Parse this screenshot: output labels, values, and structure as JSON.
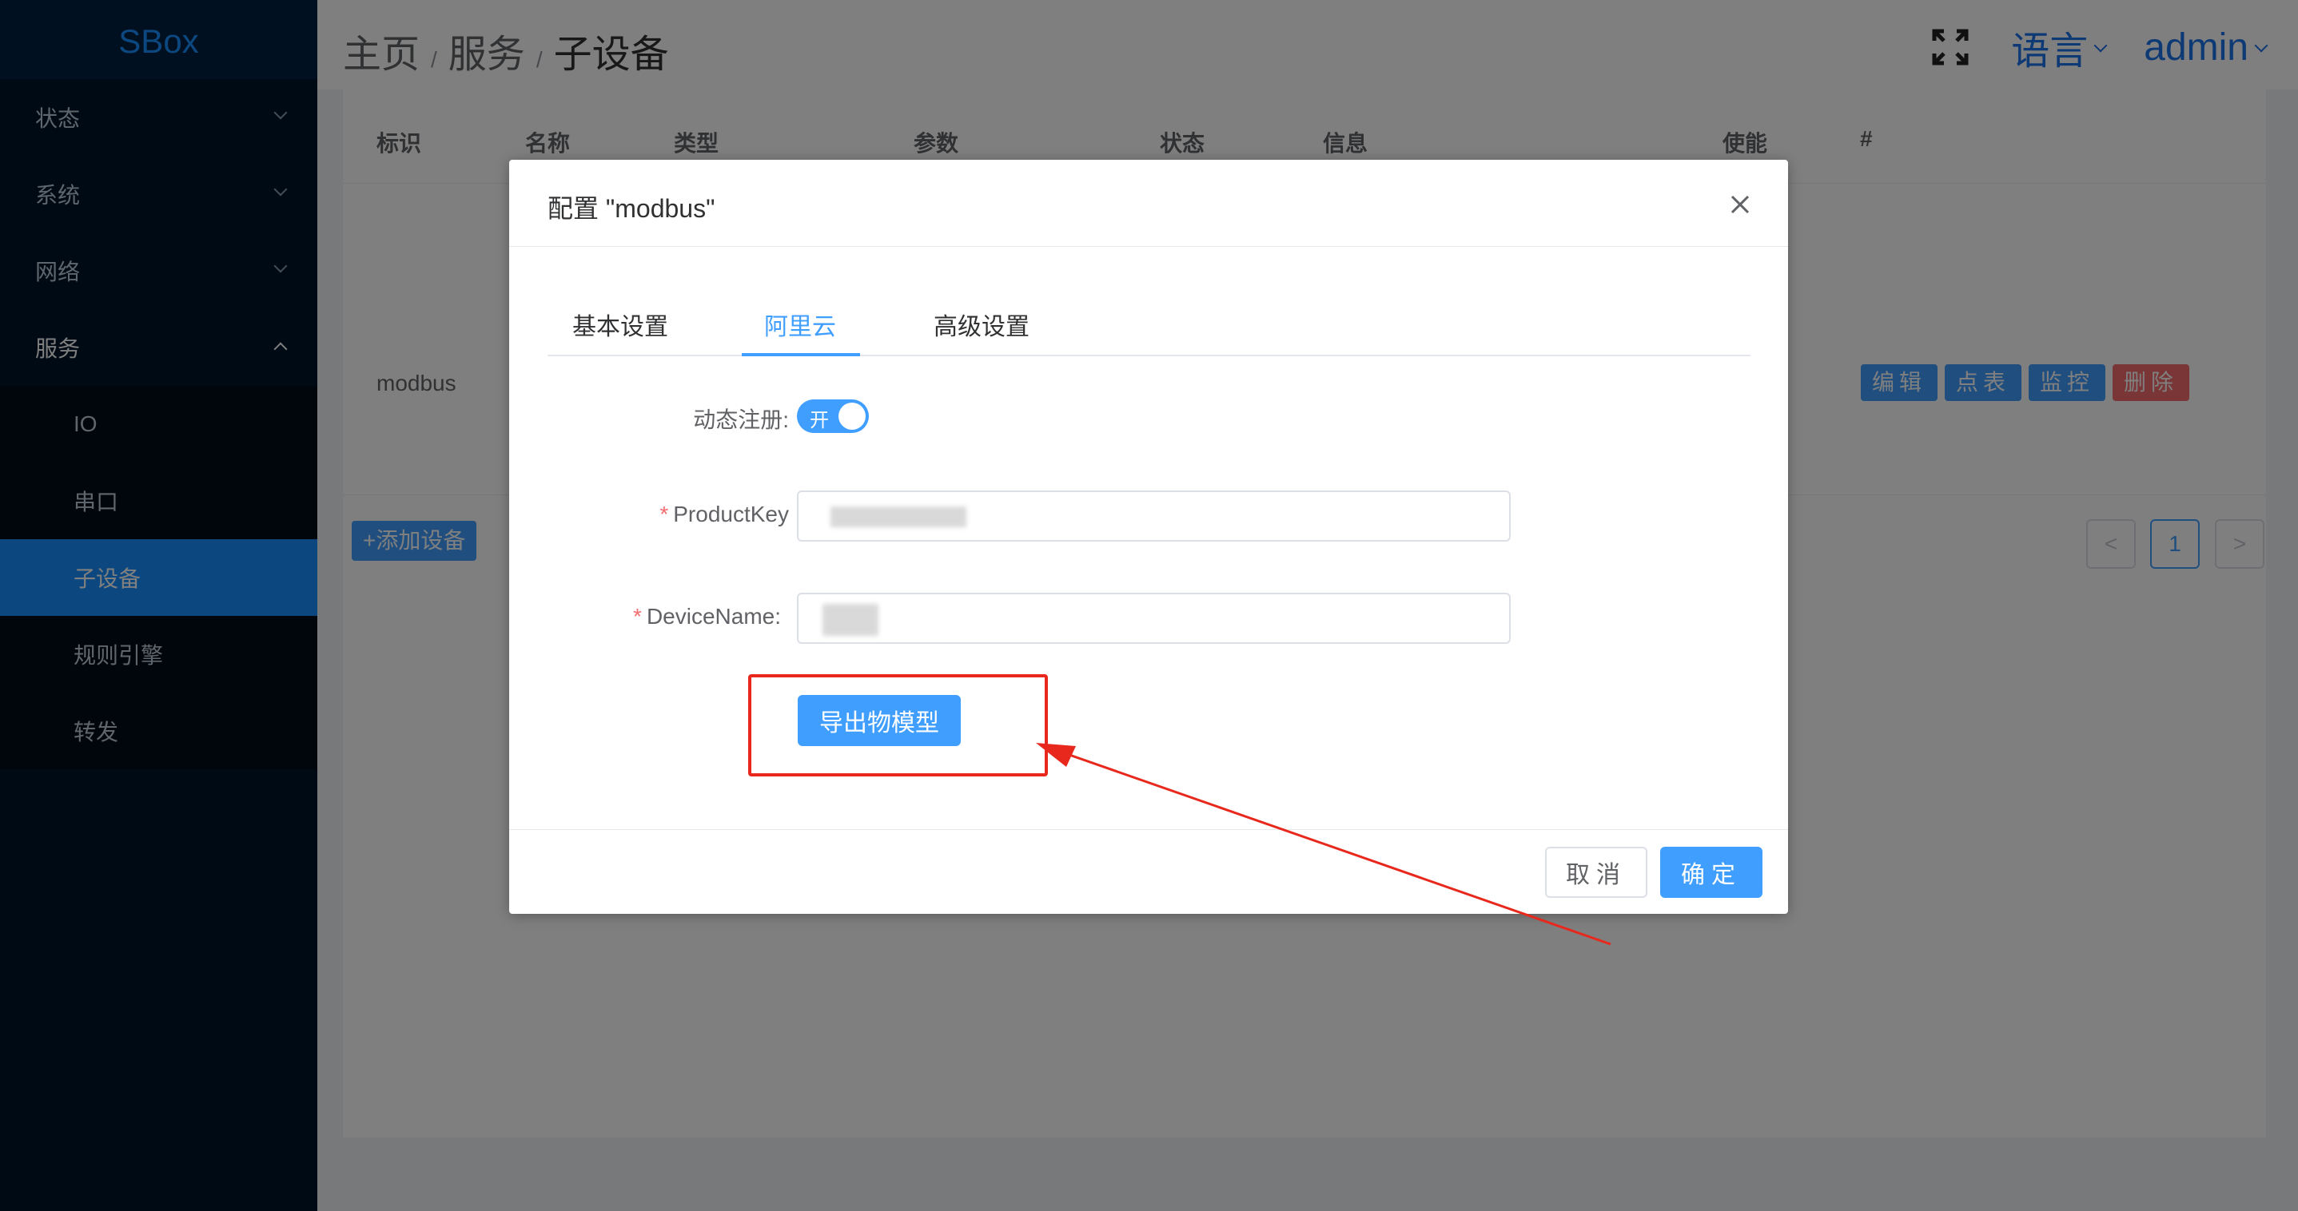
{
  "sidebar": {
    "logo": "SBox",
    "items": [
      {
        "label": "状态"
      },
      {
        "label": "系统"
      },
      {
        "label": "网络"
      },
      {
        "label": "服务"
      }
    ],
    "submenu": [
      {
        "label": "IO"
      },
      {
        "label": "串口"
      },
      {
        "label": "子设备"
      },
      {
        "label": "规则引擎"
      },
      {
        "label": "转发"
      }
    ]
  },
  "header": {
    "breadcrumb": [
      "主页",
      "服务",
      "子设备"
    ],
    "separator": "/",
    "language": "语言",
    "user": "admin"
  },
  "table": {
    "columns": [
      "标识",
      "名称",
      "类型",
      "参数",
      "状态",
      "信息",
      "使能",
      "#"
    ],
    "rows": [
      {
        "ident": "modbus"
      }
    ],
    "actions": {
      "edit": "编辑",
      "points": "点表",
      "monitor": "监控",
      "delete": "删除"
    },
    "pager": {
      "prev": "<",
      "page": "1",
      "next": ">"
    },
    "add_button": "+添加设备"
  },
  "dialog": {
    "title": "配置 \"modbus\"",
    "tabs": [
      "基本设置",
      "阿里云",
      "高级设置"
    ],
    "active_tab": "阿里云",
    "dynamic_register_label": "动态注册:",
    "switch_on_text": "开",
    "product_key_label": "ProductKey",
    "device_name_label": "DeviceName:",
    "required_mark": "*",
    "export_button": "导出物模型",
    "cancel_button": "取消",
    "ok_button": "确定"
  },
  "colors": {
    "primary": "#409eff",
    "danger": "#f56c6c",
    "sidebar_bg": "#001529",
    "highlight": "#e8281c"
  }
}
